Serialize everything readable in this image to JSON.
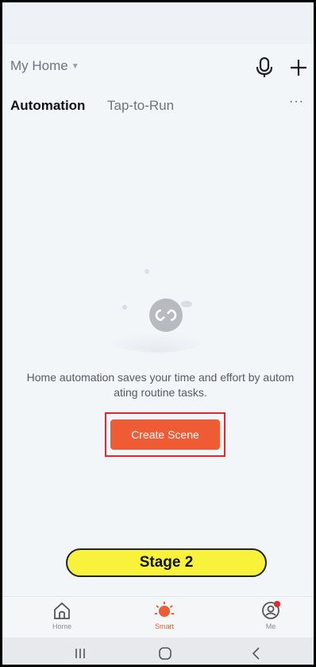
{
  "header": {
    "home_name": "My Home",
    "home_caret": "▼"
  },
  "tabs": [
    {
      "label": "Automation",
      "active": true
    },
    {
      "label": "Tap-to-Run",
      "active": false
    }
  ],
  "more_label": "···",
  "empty_state": {
    "message": "Home automation saves your time and effort by autom ating routine tasks.",
    "button_label": "Create Scene",
    "icon": "loop-icon"
  },
  "overlay": {
    "stage_label": "Stage 2"
  },
  "bottom_nav": [
    {
      "label": "Home",
      "icon": "home-icon"
    },
    {
      "label": "Smart",
      "icon": "sun-icon",
      "active": true
    },
    {
      "label": "Me",
      "icon": "profile-icon",
      "notification": true
    }
  ],
  "system_nav": [
    "recent-apps",
    "home",
    "back"
  ],
  "colors": {
    "accent": "#ef5b35",
    "highlight": "#e5262c",
    "stage_bg": "#f8f23a",
    "background": "#f3f6f9"
  }
}
